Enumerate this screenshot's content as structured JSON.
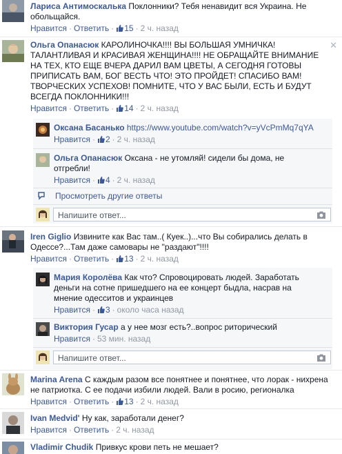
{
  "comments": [
    {
      "author": "Лариса Антимоскалька",
      "text": "Поклонники? Тебя ненавидит вся Украина. Не обольщайся.",
      "like": "Нравится",
      "reply": "Ответить",
      "likes": "15",
      "time": "2 ч. назад"
    },
    {
      "author": "Ольга Опанасюк",
      "text": "КАРОЛИНОЧКА!!!! ВЫ БОЛЬШАЯ УМНИЧКА! ТАЛАНТЛИВАЯ И КРАСИВАЯ ЖЕНЩИНА!!!! НЕ ОБРАЩАЙТЕ ВНИМАНИЕ НА ТЕХ, КТО ЕЩЕ ВЧЕРА ДАРИЛ ВАМ ЦВЕТЫ, А СЕГОДНЯ ГОТОВЫ ПРИПИСАТЬ ВАМ, БОГ ВЕСТЬ ЧТО! ЭТО ПРОЙДЕТ! СПАСИБО ВАМ! ТВОРЧЕСКИХ УСПЕХОВ! ПОМНИТЕ, ЧТО У ВАС БЫЛИ, ЕСТЬ И БУДУТ ВСЕГДА ПОКЛОННИКИ!!!",
      "like": "Нравится",
      "reply": "Ответить",
      "likes": "14",
      "time": "2 ч. назад",
      "replies": [
        {
          "author": "Оксана Басанько",
          "link": "https://www.youtube.com/watch?v=yVcPmMq7qYA",
          "like": "Нравится",
          "likes": "2",
          "time": "2 ч. назад"
        },
        {
          "author": "Ольга Опанасюк",
          "text": "Оксана - не утомляй! сидели бы дома, не отгребли!",
          "like": "Нравится",
          "likes": "4",
          "time": "2 ч. назад"
        }
      ],
      "more_replies": "Просмотреть другие ответы",
      "reply_placeholder": "Напишите ответ..."
    },
    {
      "author": "Iren Giglio",
      "text": "Извините как Вас там..( Куек..)...что Вы собирались делать в Одессе?...Там даже самовары не \"раздают\"!!!!",
      "like": "Нравится",
      "reply": "Ответить",
      "likes": "13",
      "time": "2 ч. назад",
      "replies": [
        {
          "author": "Мария Королёва",
          "text": "Как что? Спровоцировать людей. Заработать деньги на сотне пришедшего на ее концерт быдла, насрав на мнение одесситов и украинцев",
          "like": "Нравится",
          "likes": "3",
          "time": "около часа назад"
        },
        {
          "author": "Виктория Гусар",
          "text": "а у нее мозг есть?..вопрос риторический",
          "like": "Нравится",
          "time": "53 мин. назад"
        }
      ],
      "reply_placeholder": "Напишите ответ..."
    },
    {
      "author": "Marina Arena",
      "text": "С каждым разом все понятнее и понятнее, что лорак - нихрена не патриотка. С ее подачи избили людей. Вали в росию, регионалка",
      "like": "Нравится",
      "reply": "Ответить",
      "likes": "13",
      "time": "2 ч. назад"
    },
    {
      "author": "Ivan Medvid'",
      "text": "Ну как, заработали денег?",
      "like": "Нравится",
      "reply": "Ответить",
      "time": "2 ч. назад"
    },
    {
      "author": "Vladimir Chudik",
      "text": "Привкус крови петь не мешает?"
    }
  ]
}
